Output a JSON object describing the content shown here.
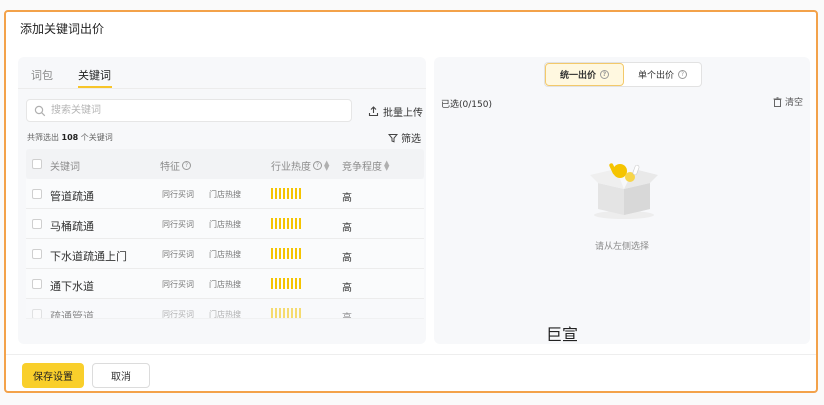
{
  "dialog": {
    "title": "添加关键词出价"
  },
  "tabs": [
    {
      "label": "词包"
    },
    {
      "label": "关键词"
    }
  ],
  "search": {
    "placeholder": "搜索关键词"
  },
  "upload": {
    "label": "批量上传"
  },
  "count": {
    "prefix": "共筛选出 ",
    "number": "108",
    "suffix": " 个关键词"
  },
  "filter": {
    "label": "筛选"
  },
  "table": {
    "headers": {
      "keyword": "关键词",
      "feature": "特征",
      "heat": "行业热度",
      "competition": "竞争程度"
    },
    "rows": [
      {
        "keyword": "管道疏通",
        "tag1": "同行买词",
        "tag2": "门店热搜",
        "competition": "高"
      },
      {
        "keyword": "马桶疏通",
        "tag1": "同行买词",
        "tag2": "门店热搜",
        "competition": "高"
      },
      {
        "keyword": "下水道疏通上门",
        "tag1": "同行买词",
        "tag2": "门店热搜",
        "competition": "高"
      },
      {
        "keyword": "通下水道",
        "tag1": "同行买词",
        "tag2": "门店热搜",
        "competition": "高"
      },
      {
        "keyword": "疏通管道",
        "tag1": "同行买词",
        "tag2": "门店热搜",
        "competition": "高"
      }
    ]
  },
  "right": {
    "bid_options": [
      {
        "label": "统一出价"
      },
      {
        "label": "单个出价"
      }
    ],
    "selected": "已选(0/150)",
    "clear": "清空",
    "empty": "请从左侧选择"
  },
  "watermark": "巨宣",
  "footer": {
    "save": "保存设置",
    "cancel": "取消"
  },
  "colors": {
    "accent": "#f9cf2b",
    "border": "#f3a24a"
  }
}
